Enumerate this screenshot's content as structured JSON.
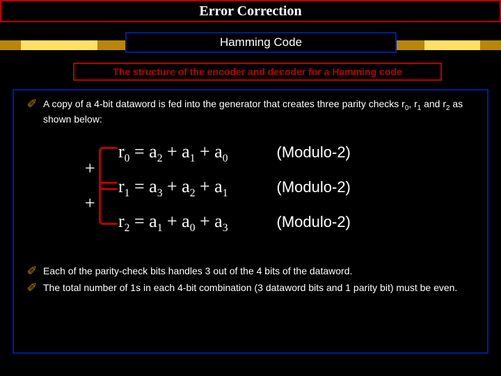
{
  "title": "Error Correction",
  "subtitle": "Hamming Code",
  "caption": "The structure of the encoder and decoder for a Hamming code",
  "bullets": {
    "b1_prefix": "A copy of a 4-bit dataword is fed into the generator that creates three parity checks r",
    "b1_mid1": ", r",
    "b1_mid2": " and r",
    "b1_suffix": " as shown below:",
    "b2": "Each of the parity-check bits handles 3 out of the 4 bits of the dataword.",
    "b3": "The total number of 1s in each 4-bit combination (3 dataword bits and 1 parity bit) must be even."
  },
  "equations": {
    "eq1": {
      "lhs_var": "r",
      "lhs_sub": "0",
      "t1v": "a",
      "t1s": "2",
      "t2v": "a",
      "t2s": "1",
      "t3v": "a",
      "t3s": "0",
      "mod": "(Modulo-2)"
    },
    "eq2": {
      "lhs_var": "r",
      "lhs_sub": "1",
      "t1v": "a",
      "t1s": "3",
      "t2v": "a",
      "t2s": "2",
      "t3v": "a",
      "t3s": "1",
      "mod": "(Modulo-2)"
    },
    "eq3": {
      "lhs_var": "r",
      "lhs_sub": "2",
      "t1v": "a",
      "t1s": "1",
      "t2v": "a",
      "t2s": "0",
      "t3v": "a",
      "t3s": "3",
      "mod": "(Modulo-2)"
    },
    "plus1": "+",
    "plus2": "+",
    "equals": " = ",
    "plus_inline": " + "
  },
  "subs": {
    "s0": "0",
    "s1": "1",
    "s2": "2"
  }
}
